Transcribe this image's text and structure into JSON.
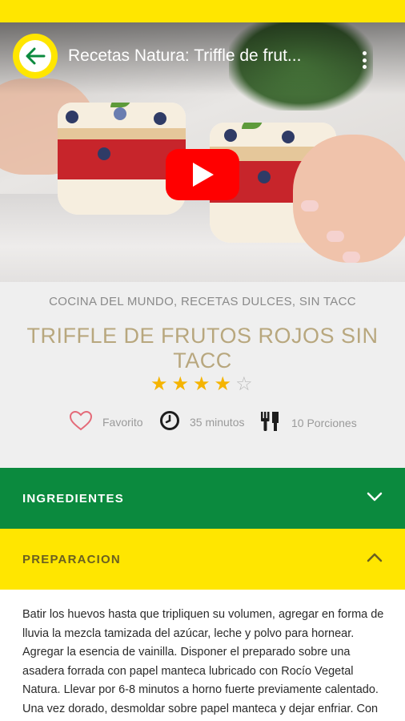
{
  "video": {
    "title": "Recetas Natura: Triffle de frut..."
  },
  "recipe": {
    "categories": "COCINA DEL MUNDO, RECETAS DULCES, SIN TACC",
    "title": "TRIFFLE DE FRUTOS ROJOS SIN TACC",
    "rating": 4,
    "rating_max": 5,
    "favorite_label": "Favorito",
    "time_label": "35 minutos",
    "portions_label": "10 Porciones"
  },
  "sections": {
    "ingredients_label": "INGREDIENTES",
    "preparation_label": "PREPARACION",
    "preparation_text": "Batir los huevos hasta que tripliquen su volumen, agregar en forma de lluvia la mezcla tamizada del azúcar, leche y polvo para hornear. Agregar la esencia de vainilla. Disponer el preparado sobre una asadera forrada con papel manteca lubricado con Rocío Vegetal Natura. Llevar por 6-8 minutos a horno fuerte previamente calentado. Una vez dorado, desmoldar sobre papel manteca y dejar enfriar. Con un cortante apenas más chico que las copas"
  },
  "icons": {
    "back": "arrow-left-icon",
    "menu": "more-vertical-icon",
    "play": "youtube-play-icon",
    "favorite": "heart-icon",
    "time": "clock-icon",
    "portions": "cutlery-icon",
    "ingredients_toggle": "chevron-down-icon",
    "preparation_toggle": "chevron-up-icon"
  },
  "colors": {
    "brand_yellow": "#ffe600",
    "brand_green": "#0b8a3e",
    "title_gold": "#b8a77e",
    "star": "#f5b400",
    "youtube_red": "#ff0000"
  }
}
